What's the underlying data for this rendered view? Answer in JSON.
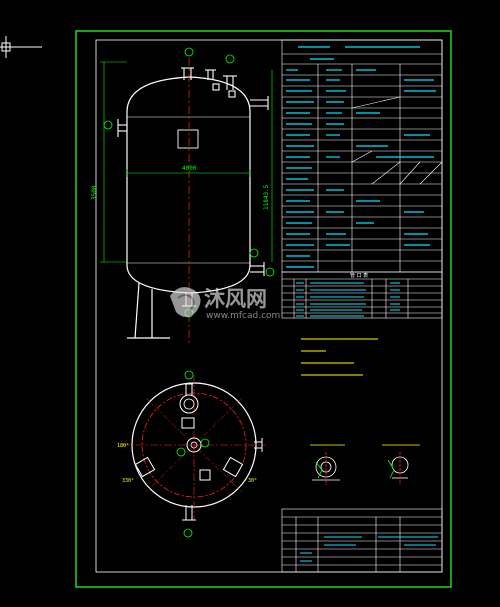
{
  "viewer": {
    "background": "#000000",
    "frame_color": "#21d821",
    "line_white": "#ffffff",
    "line_green": "#00ff00",
    "line_red": "#ff2020",
    "line_yellow": "#ffff00",
    "text_cyan": "#00e5ff"
  },
  "drawing": {
    "dim_total_height": "11843.5",
    "dim_width": "4000",
    "dim_left": "3500",
    "dim_top": "3500",
    "nozzle_labels": [
      "E",
      "B",
      "A",
      "C",
      "D",
      "F"
    ],
    "notes": [
      "1、本设备按照GB150-98《钢制压力容器》标准制造",
      "2、焊接采用电弧焊",
      "3、焊条牌号J422",
      "4、管法兰按HG20592-97",
      "5、本设备需做水压试验",
      "6、设计压力1.0MPa"
    ],
    "plan_labels": [
      "E",
      "A",
      "D",
      "F",
      "C",
      "B"
    ],
    "plan_angles": [
      "0°",
      "90°",
      "180°",
      "270°",
      "30°",
      "330°"
    ],
    "detail_labels": [
      "A-A 放大",
      "C-C 接管放大"
    ],
    "parts_table_title": "管 口 表",
    "title_block": {
      "name": "40立方储罐",
      "company": "沐风网"
    }
  },
  "watermark": {
    "brand": "沐风网",
    "url": "www.mfcad.com"
  }
}
